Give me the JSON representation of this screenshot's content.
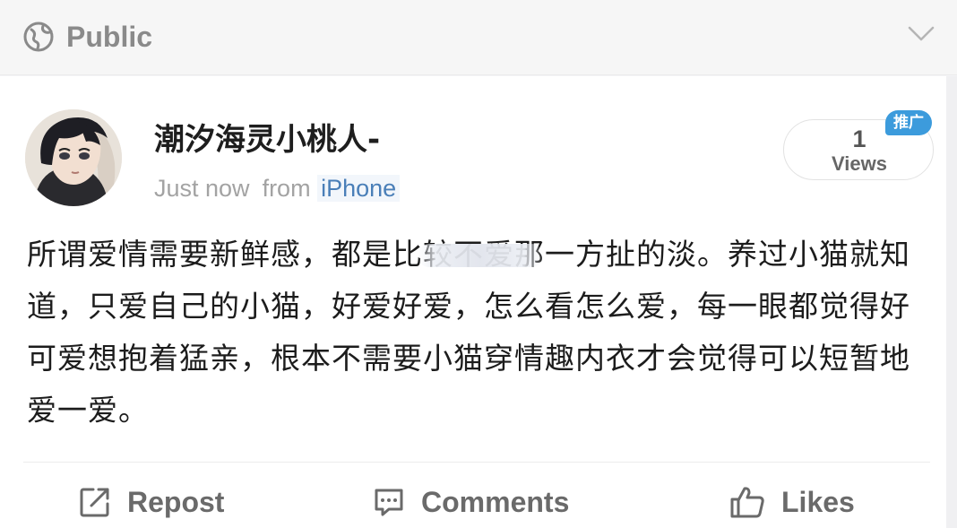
{
  "header": {
    "visibility_label": "Public",
    "visibility_icon": "globe-icon",
    "expand_icon": "chevron-down-icon"
  },
  "post": {
    "username": "潮汐海灵小桃人-",
    "timestamp": "Just now",
    "source_prefix": "from",
    "source_device": "iPhone",
    "views_count": "1",
    "views_label": "Views",
    "promo_badge": "推广",
    "content": "所谓爱情需要新鲜感，都是比较不爱那一方扯的淡。养过小猫就知道，只爱自己的小猫，好爱好爱，怎么看怎么爱，每一眼都觉得好可爱想抱着猛亲，根本不需要小猫穿情趣内衣才会觉得可以短暂地爱一爱。"
  },
  "actions": {
    "repost_label": "Repost",
    "comments_label": "Comments",
    "likes_label": "Likes"
  },
  "colors": {
    "link_blue": "#4a7fb8",
    "badge_blue": "#3c9bdc",
    "muted_gray": "#a3a3a3"
  }
}
